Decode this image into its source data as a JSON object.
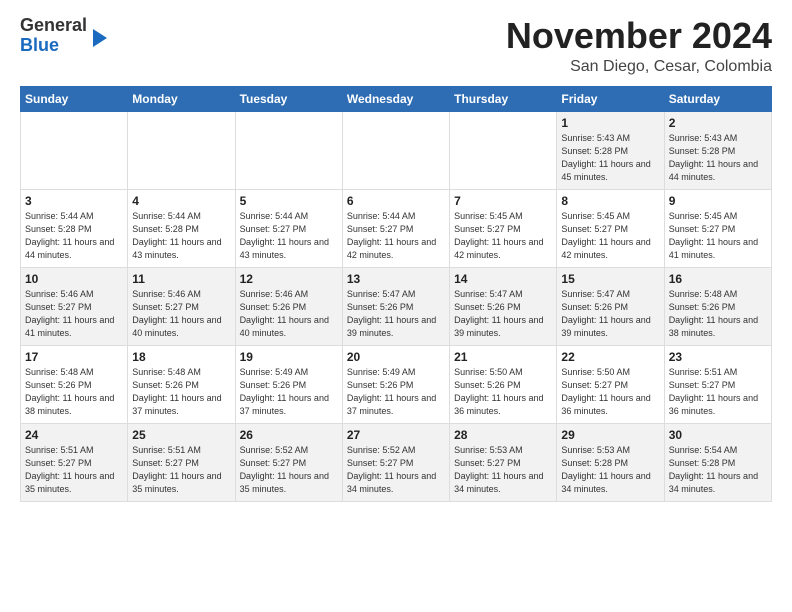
{
  "logo": {
    "line1": "General",
    "line2": "Blue"
  },
  "title": "November 2024",
  "location": "San Diego, Cesar, Colombia",
  "weekdays": [
    "Sunday",
    "Monday",
    "Tuesday",
    "Wednesday",
    "Thursday",
    "Friday",
    "Saturday"
  ],
  "weeks": [
    [
      {
        "day": "",
        "info": ""
      },
      {
        "day": "",
        "info": ""
      },
      {
        "day": "",
        "info": ""
      },
      {
        "day": "",
        "info": ""
      },
      {
        "day": "",
        "info": ""
      },
      {
        "day": "1",
        "info": "Sunrise: 5:43 AM\nSunset: 5:28 PM\nDaylight: 11 hours and 45 minutes."
      },
      {
        "day": "2",
        "info": "Sunrise: 5:43 AM\nSunset: 5:28 PM\nDaylight: 11 hours and 44 minutes."
      }
    ],
    [
      {
        "day": "3",
        "info": "Sunrise: 5:44 AM\nSunset: 5:28 PM\nDaylight: 11 hours and 44 minutes."
      },
      {
        "day": "4",
        "info": "Sunrise: 5:44 AM\nSunset: 5:28 PM\nDaylight: 11 hours and 43 minutes."
      },
      {
        "day": "5",
        "info": "Sunrise: 5:44 AM\nSunset: 5:27 PM\nDaylight: 11 hours and 43 minutes."
      },
      {
        "day": "6",
        "info": "Sunrise: 5:44 AM\nSunset: 5:27 PM\nDaylight: 11 hours and 42 minutes."
      },
      {
        "day": "7",
        "info": "Sunrise: 5:45 AM\nSunset: 5:27 PM\nDaylight: 11 hours and 42 minutes."
      },
      {
        "day": "8",
        "info": "Sunrise: 5:45 AM\nSunset: 5:27 PM\nDaylight: 11 hours and 42 minutes."
      },
      {
        "day": "9",
        "info": "Sunrise: 5:45 AM\nSunset: 5:27 PM\nDaylight: 11 hours and 41 minutes."
      }
    ],
    [
      {
        "day": "10",
        "info": "Sunrise: 5:46 AM\nSunset: 5:27 PM\nDaylight: 11 hours and 41 minutes."
      },
      {
        "day": "11",
        "info": "Sunrise: 5:46 AM\nSunset: 5:27 PM\nDaylight: 11 hours and 40 minutes."
      },
      {
        "day": "12",
        "info": "Sunrise: 5:46 AM\nSunset: 5:26 PM\nDaylight: 11 hours and 40 minutes."
      },
      {
        "day": "13",
        "info": "Sunrise: 5:47 AM\nSunset: 5:26 PM\nDaylight: 11 hours and 39 minutes."
      },
      {
        "day": "14",
        "info": "Sunrise: 5:47 AM\nSunset: 5:26 PM\nDaylight: 11 hours and 39 minutes."
      },
      {
        "day": "15",
        "info": "Sunrise: 5:47 AM\nSunset: 5:26 PM\nDaylight: 11 hours and 39 minutes."
      },
      {
        "day": "16",
        "info": "Sunrise: 5:48 AM\nSunset: 5:26 PM\nDaylight: 11 hours and 38 minutes."
      }
    ],
    [
      {
        "day": "17",
        "info": "Sunrise: 5:48 AM\nSunset: 5:26 PM\nDaylight: 11 hours and 38 minutes."
      },
      {
        "day": "18",
        "info": "Sunrise: 5:48 AM\nSunset: 5:26 PM\nDaylight: 11 hours and 37 minutes."
      },
      {
        "day": "19",
        "info": "Sunrise: 5:49 AM\nSunset: 5:26 PM\nDaylight: 11 hours and 37 minutes."
      },
      {
        "day": "20",
        "info": "Sunrise: 5:49 AM\nSunset: 5:26 PM\nDaylight: 11 hours and 37 minutes."
      },
      {
        "day": "21",
        "info": "Sunrise: 5:50 AM\nSunset: 5:26 PM\nDaylight: 11 hours and 36 minutes."
      },
      {
        "day": "22",
        "info": "Sunrise: 5:50 AM\nSunset: 5:27 PM\nDaylight: 11 hours and 36 minutes."
      },
      {
        "day": "23",
        "info": "Sunrise: 5:51 AM\nSunset: 5:27 PM\nDaylight: 11 hours and 36 minutes."
      }
    ],
    [
      {
        "day": "24",
        "info": "Sunrise: 5:51 AM\nSunset: 5:27 PM\nDaylight: 11 hours and 35 minutes."
      },
      {
        "day": "25",
        "info": "Sunrise: 5:51 AM\nSunset: 5:27 PM\nDaylight: 11 hours and 35 minutes."
      },
      {
        "day": "26",
        "info": "Sunrise: 5:52 AM\nSunset: 5:27 PM\nDaylight: 11 hours and 35 minutes."
      },
      {
        "day": "27",
        "info": "Sunrise: 5:52 AM\nSunset: 5:27 PM\nDaylight: 11 hours and 34 minutes."
      },
      {
        "day": "28",
        "info": "Sunrise: 5:53 AM\nSunset: 5:27 PM\nDaylight: 11 hours and 34 minutes."
      },
      {
        "day": "29",
        "info": "Sunrise: 5:53 AM\nSunset: 5:28 PM\nDaylight: 11 hours and 34 minutes."
      },
      {
        "day": "30",
        "info": "Sunrise: 5:54 AM\nSunset: 5:28 PM\nDaylight: 11 hours and 34 minutes."
      }
    ]
  ]
}
